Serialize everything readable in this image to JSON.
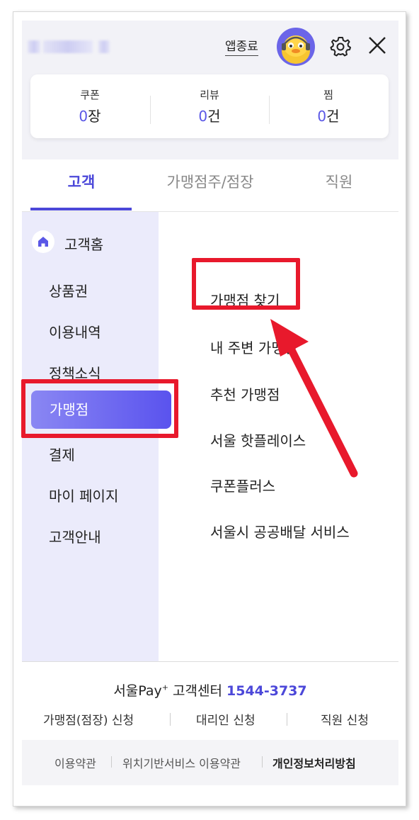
{
  "header": {
    "exit_label": "앱종료",
    "stats": [
      {
        "label": "쿠폰",
        "value": "0",
        "unit": "장"
      },
      {
        "label": "리뷰",
        "value": "0",
        "unit": "건"
      },
      {
        "label": "찜",
        "value": "0",
        "unit": "건"
      }
    ],
    "icons": {
      "avatar": "character-avatar",
      "settings": "gear-icon",
      "close": "close-icon"
    }
  },
  "tabs": [
    {
      "label": "고객",
      "active": true
    },
    {
      "label": "가맹점주/점장",
      "active": false
    },
    {
      "label": "직원",
      "active": false
    }
  ],
  "sidebar": {
    "home_label": "고객홈",
    "items": [
      {
        "label": "상품권"
      },
      {
        "label": "이용내역"
      },
      {
        "label": "정책소식"
      },
      {
        "label": "가맹점",
        "active": true
      },
      {
        "label": "결제"
      },
      {
        "label": "마이 페이지"
      },
      {
        "label": "고객안내"
      }
    ]
  },
  "content": {
    "items": [
      {
        "label": "가맹점 찾기"
      },
      {
        "label": "내 주변 가맹점"
      },
      {
        "label": "추천 가맹점"
      },
      {
        "label": "서울 핫플레이스"
      },
      {
        "label": "쿠폰플러스"
      },
      {
        "label": "서울시 공공배달 서비스"
      }
    ]
  },
  "footer": {
    "cs_prefix": "서울Pay",
    "cs_sup": "+",
    "cs_center": " 고객센터 ",
    "cs_phone": "1544-3737",
    "apply_links": [
      {
        "label": "가맹점(점장) 신청"
      },
      {
        "label": "대리인 신청"
      },
      {
        "label": "직원 신청"
      }
    ],
    "terms": [
      {
        "label": "이용약관"
      },
      {
        "label": "위치기반서비스 이용약관"
      },
      {
        "label": "개인정보처리방침"
      }
    ]
  },
  "colors": {
    "accent": "#4c48d9",
    "highlight": "#e8192c",
    "sidebar_bg": "#ebebfb"
  }
}
